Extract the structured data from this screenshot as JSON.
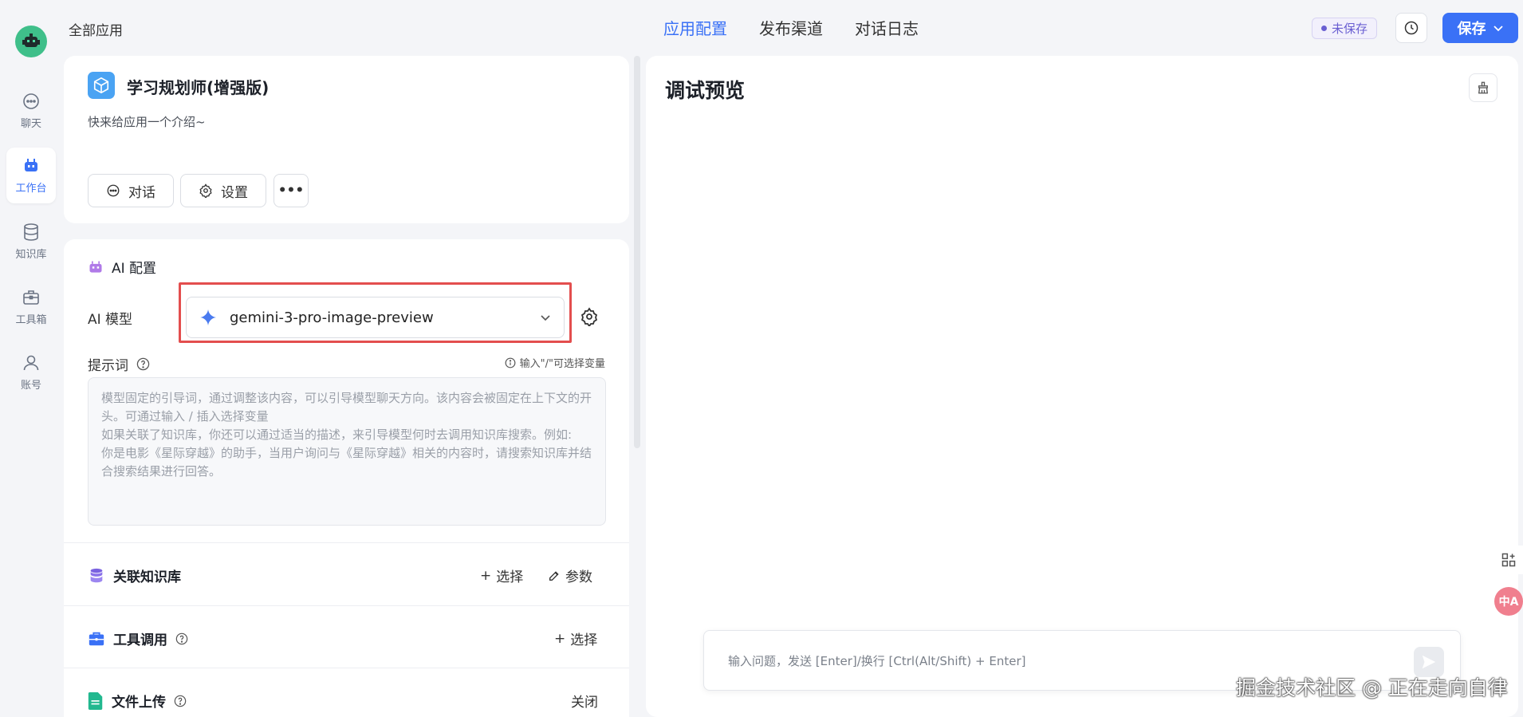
{
  "nav": {
    "items": [
      {
        "label": "聊天",
        "icon": "chat-icon"
      },
      {
        "label": "工作台",
        "icon": "robot-icon",
        "active": true
      },
      {
        "label": "知识库",
        "icon": "database-icon"
      },
      {
        "label": "工具箱",
        "icon": "toolbox-icon"
      },
      {
        "label": "账号",
        "icon": "user-icon"
      }
    ]
  },
  "header": {
    "breadcrumb": "全部应用",
    "tabs": [
      "应用配置",
      "发布渠道",
      "对话日志"
    ],
    "unsaved_label": "未保存",
    "save_label": "保存",
    "accent": "#3a71f6"
  },
  "app": {
    "name": "学习规划师(增强版)",
    "description": "快来给应用一个介绍~",
    "chat_button": "对话",
    "settings_button": "设置",
    "more_button": "•••"
  },
  "ai_config": {
    "title": "AI 配置",
    "model_label": "AI 模型",
    "model_value": "gemini-3-pro-image-preview",
    "prompt_label": "提示词",
    "prompt_hint": "输入\"/\"可选择变量",
    "prompt_placeholder_lines": [
      "模型固定的引导词，通过调整该内容，可以引导模型聊天方向。该内容会被固定在上下文的开",
      "头。可通过输入 / 插入选择变量",
      "如果关联了知识库，你还可以通过适当的描述，来引导模型何时去调用知识库搜索。例如:",
      "你是电影《星际穿越》的助手，当用户询问与《星际穿越》相关的内容时，请搜索知识库并结",
      "合搜索结果进行回答。"
    ]
  },
  "sections": {
    "knowledge": {
      "title": "关联知识库",
      "select": "选择",
      "params": "参数"
    },
    "tools": {
      "title": "工具调用",
      "select": "选择"
    },
    "upload": {
      "title": "文件上传",
      "status": "关闭"
    }
  },
  "preview": {
    "title": "调试预览",
    "input_placeholder": "输入问题，发送 [Enter]/换行 [Ctrl(Alt/Shift) + Enter]"
  },
  "floating": {
    "translate_label": "中A"
  },
  "watermark": "掘金技术社区 @ 正在走向自律"
}
